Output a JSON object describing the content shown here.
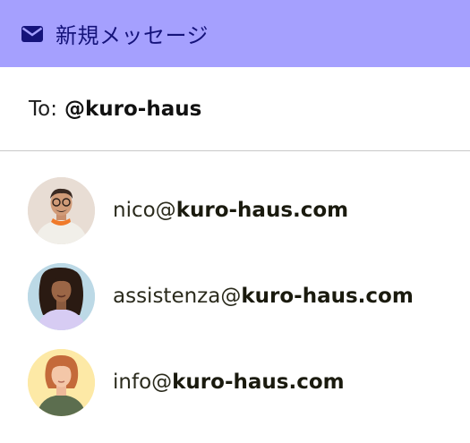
{
  "header": {
    "title": "新規メッセージ",
    "icon": "envelope-icon",
    "background": "#a5a0fe",
    "text_color": "#15137a"
  },
  "compose": {
    "to_label": "To:",
    "to_value": "@kuro-haus"
  },
  "suggestions": [
    {
      "user": "nico@",
      "domain": "kuro-haus.com",
      "avatar_bg": "#e8ddd4"
    },
    {
      "user": "assistenza@",
      "domain": "kuro-haus.com",
      "avatar_bg": "#bcd9e6"
    },
    {
      "user": "info@",
      "domain": "kuro-haus.com",
      "avatar_bg": "#fde9a6"
    }
  ]
}
